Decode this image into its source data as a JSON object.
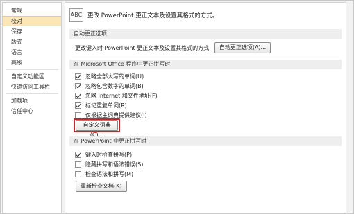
{
  "sidebar": {
    "items": [
      {
        "label": "常规",
        "selected": false
      },
      {
        "label": "校对",
        "selected": true
      },
      {
        "label": "保存",
        "selected": false
      },
      {
        "label": "版式",
        "selected": false
      },
      {
        "label": "语言",
        "selected": false
      },
      {
        "label": "高级",
        "selected": false
      },
      {
        "label": "自定义功能区",
        "selected": false
      },
      {
        "label": "快速访问工具栏",
        "selected": false
      },
      {
        "label": "加载项",
        "selected": false
      },
      {
        "label": "信任中心",
        "selected": false
      }
    ]
  },
  "header": {
    "icon_text": "ABC",
    "text": "更改 PowerPoint 更正文本及设置其格式的方式。"
  },
  "autocorrect": {
    "title": "自动更正选项",
    "label": "更改键入时 PowerPoint 更正文本及设置其格式的方式:",
    "button": "自动更正选项(A)..."
  },
  "office_spelling": {
    "title": "在 Microsoft Office 程序中更正拼写时",
    "options": [
      {
        "label": "忽略全部大写的单词(U)",
        "checked": true
      },
      {
        "label": "忽略包含数字的单词(B)",
        "checked": true
      },
      {
        "label": "忽略 Internet 和文件地址(F)",
        "checked": true
      },
      {
        "label": "标记重复单词(R)",
        "checked": true
      },
      {
        "label": "仅根据主词典提供建议(I)",
        "checked": false
      }
    ],
    "custom_dict_button": "自定义词典(C)..."
  },
  "ppt_spelling": {
    "title": "在 PowerPoint 中更正拼写时",
    "options": [
      {
        "label": "键入时检查拼写(P)",
        "checked": true
      },
      {
        "label": "隐藏拼写和语法错误(S)",
        "checked": false
      },
      {
        "label": "检查语法和拼写(M)",
        "checked": false
      }
    ],
    "recheck_button": "重新检查文档(K)"
  },
  "colors": {
    "highlight": "#c0282d",
    "selected_bg": "#fbe6b8"
  }
}
